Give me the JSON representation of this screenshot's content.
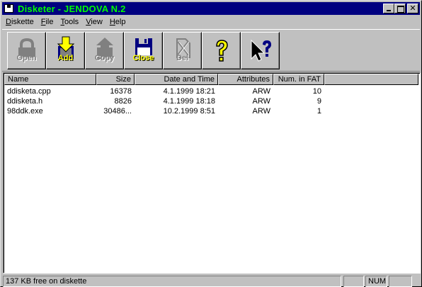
{
  "window": {
    "title": "Disketer - JENDOVA N.2"
  },
  "menu": [
    {
      "label": "Diskette",
      "key": "D"
    },
    {
      "label": "File",
      "key": "F"
    },
    {
      "label": "Tools",
      "key": "T"
    },
    {
      "label": "View",
      "key": "V"
    },
    {
      "label": "Help",
      "key": "H"
    }
  ],
  "toolbar": {
    "open_label": "Open",
    "add_label": "Add",
    "copy_label": "Copy",
    "close_label": "Close",
    "del_label": "Del",
    "help_icon": "question-icon",
    "context_help_icon": "pointer-question-icon"
  },
  "list": {
    "columns": [
      "Name",
      "Size",
      "Date and Time",
      "Attributes",
      "Num. in FAT"
    ],
    "rows": [
      {
        "name": "ddisketa.cpp",
        "size": "16378",
        "date": "4.1.1999  18:21",
        "attr": "ARW",
        "fat": "10"
      },
      {
        "name": "ddisketa.h",
        "size": "8826",
        "date": "4.1.1999  18:18",
        "attr": "ARW",
        "fat": "9"
      },
      {
        "name": "98ddk.exe",
        "size": "30486...",
        "date": "10.2.1999  8:51",
        "attr": "ARW",
        "fat": "1"
      }
    ]
  },
  "status": {
    "message": "137 KB free on diskette",
    "pane1": "",
    "pane2": "NUM",
    "pane3": ""
  },
  "colors": {
    "title_bg": "#000080",
    "title_text": "#00ff00",
    "active_label": "#ffff00",
    "face": "#c0c0c0"
  }
}
